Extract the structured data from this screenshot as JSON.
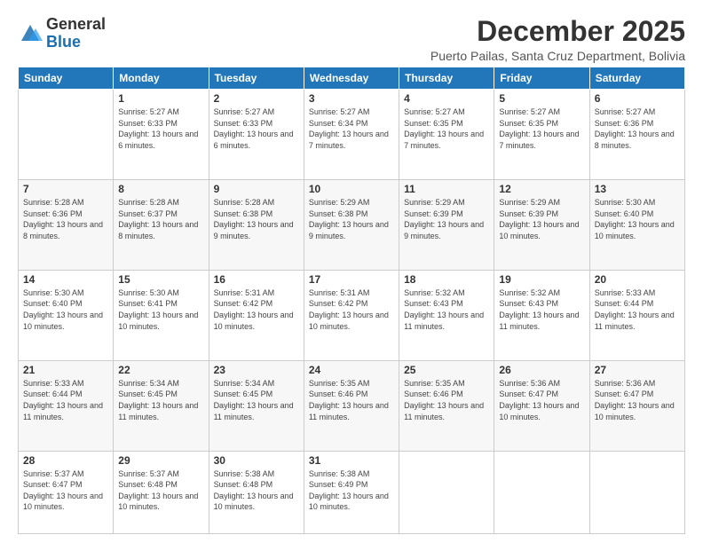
{
  "logo": {
    "general": "General",
    "blue": "Blue"
  },
  "header": {
    "month_title": "December 2025",
    "location": "Puerto Pailas, Santa Cruz Department, Bolivia"
  },
  "days_of_week": [
    "Sunday",
    "Monday",
    "Tuesday",
    "Wednesday",
    "Thursday",
    "Friday",
    "Saturday"
  ],
  "weeks": [
    [
      {
        "day": "",
        "sunrise": "",
        "sunset": "",
        "daylight": ""
      },
      {
        "day": "1",
        "sunrise": "Sunrise: 5:27 AM",
        "sunset": "Sunset: 6:33 PM",
        "daylight": "Daylight: 13 hours and 6 minutes."
      },
      {
        "day": "2",
        "sunrise": "Sunrise: 5:27 AM",
        "sunset": "Sunset: 6:33 PM",
        "daylight": "Daylight: 13 hours and 6 minutes."
      },
      {
        "day": "3",
        "sunrise": "Sunrise: 5:27 AM",
        "sunset": "Sunset: 6:34 PM",
        "daylight": "Daylight: 13 hours and 7 minutes."
      },
      {
        "day": "4",
        "sunrise": "Sunrise: 5:27 AM",
        "sunset": "Sunset: 6:35 PM",
        "daylight": "Daylight: 13 hours and 7 minutes."
      },
      {
        "day": "5",
        "sunrise": "Sunrise: 5:27 AM",
        "sunset": "Sunset: 6:35 PM",
        "daylight": "Daylight: 13 hours and 7 minutes."
      },
      {
        "day": "6",
        "sunrise": "Sunrise: 5:27 AM",
        "sunset": "Sunset: 6:36 PM",
        "daylight": "Daylight: 13 hours and 8 minutes."
      }
    ],
    [
      {
        "day": "7",
        "sunrise": "Sunrise: 5:28 AM",
        "sunset": "Sunset: 6:36 PM",
        "daylight": "Daylight: 13 hours and 8 minutes."
      },
      {
        "day": "8",
        "sunrise": "Sunrise: 5:28 AM",
        "sunset": "Sunset: 6:37 PM",
        "daylight": "Daylight: 13 hours and 8 minutes."
      },
      {
        "day": "9",
        "sunrise": "Sunrise: 5:28 AM",
        "sunset": "Sunset: 6:38 PM",
        "daylight": "Daylight: 13 hours and 9 minutes."
      },
      {
        "day": "10",
        "sunrise": "Sunrise: 5:29 AM",
        "sunset": "Sunset: 6:38 PM",
        "daylight": "Daylight: 13 hours and 9 minutes."
      },
      {
        "day": "11",
        "sunrise": "Sunrise: 5:29 AM",
        "sunset": "Sunset: 6:39 PM",
        "daylight": "Daylight: 13 hours and 9 minutes."
      },
      {
        "day": "12",
        "sunrise": "Sunrise: 5:29 AM",
        "sunset": "Sunset: 6:39 PM",
        "daylight": "Daylight: 13 hours and 10 minutes."
      },
      {
        "day": "13",
        "sunrise": "Sunrise: 5:30 AM",
        "sunset": "Sunset: 6:40 PM",
        "daylight": "Daylight: 13 hours and 10 minutes."
      }
    ],
    [
      {
        "day": "14",
        "sunrise": "Sunrise: 5:30 AM",
        "sunset": "Sunset: 6:40 PM",
        "daylight": "Daylight: 13 hours and 10 minutes."
      },
      {
        "day": "15",
        "sunrise": "Sunrise: 5:30 AM",
        "sunset": "Sunset: 6:41 PM",
        "daylight": "Daylight: 13 hours and 10 minutes."
      },
      {
        "day": "16",
        "sunrise": "Sunrise: 5:31 AM",
        "sunset": "Sunset: 6:42 PM",
        "daylight": "Daylight: 13 hours and 10 minutes."
      },
      {
        "day": "17",
        "sunrise": "Sunrise: 5:31 AM",
        "sunset": "Sunset: 6:42 PM",
        "daylight": "Daylight: 13 hours and 10 minutes."
      },
      {
        "day": "18",
        "sunrise": "Sunrise: 5:32 AM",
        "sunset": "Sunset: 6:43 PM",
        "daylight": "Daylight: 13 hours and 11 minutes."
      },
      {
        "day": "19",
        "sunrise": "Sunrise: 5:32 AM",
        "sunset": "Sunset: 6:43 PM",
        "daylight": "Daylight: 13 hours and 11 minutes."
      },
      {
        "day": "20",
        "sunrise": "Sunrise: 5:33 AM",
        "sunset": "Sunset: 6:44 PM",
        "daylight": "Daylight: 13 hours and 11 minutes."
      }
    ],
    [
      {
        "day": "21",
        "sunrise": "Sunrise: 5:33 AM",
        "sunset": "Sunset: 6:44 PM",
        "daylight": "Daylight: 13 hours and 11 minutes."
      },
      {
        "day": "22",
        "sunrise": "Sunrise: 5:34 AM",
        "sunset": "Sunset: 6:45 PM",
        "daylight": "Daylight: 13 hours and 11 minutes."
      },
      {
        "day": "23",
        "sunrise": "Sunrise: 5:34 AM",
        "sunset": "Sunset: 6:45 PM",
        "daylight": "Daylight: 13 hours and 11 minutes."
      },
      {
        "day": "24",
        "sunrise": "Sunrise: 5:35 AM",
        "sunset": "Sunset: 6:46 PM",
        "daylight": "Daylight: 13 hours and 11 minutes."
      },
      {
        "day": "25",
        "sunrise": "Sunrise: 5:35 AM",
        "sunset": "Sunset: 6:46 PM",
        "daylight": "Daylight: 13 hours and 11 minutes."
      },
      {
        "day": "26",
        "sunrise": "Sunrise: 5:36 AM",
        "sunset": "Sunset: 6:47 PM",
        "daylight": "Daylight: 13 hours and 10 minutes."
      },
      {
        "day": "27",
        "sunrise": "Sunrise: 5:36 AM",
        "sunset": "Sunset: 6:47 PM",
        "daylight": "Daylight: 13 hours and 10 minutes."
      }
    ],
    [
      {
        "day": "28",
        "sunrise": "Sunrise: 5:37 AM",
        "sunset": "Sunset: 6:47 PM",
        "daylight": "Daylight: 13 hours and 10 minutes."
      },
      {
        "day": "29",
        "sunrise": "Sunrise: 5:37 AM",
        "sunset": "Sunset: 6:48 PM",
        "daylight": "Daylight: 13 hours and 10 minutes."
      },
      {
        "day": "30",
        "sunrise": "Sunrise: 5:38 AM",
        "sunset": "Sunset: 6:48 PM",
        "daylight": "Daylight: 13 hours and 10 minutes."
      },
      {
        "day": "31",
        "sunrise": "Sunrise: 5:38 AM",
        "sunset": "Sunset: 6:49 PM",
        "daylight": "Daylight: 13 hours and 10 minutes."
      },
      {
        "day": "",
        "sunrise": "",
        "sunset": "",
        "daylight": ""
      },
      {
        "day": "",
        "sunrise": "",
        "sunset": "",
        "daylight": ""
      },
      {
        "day": "",
        "sunrise": "",
        "sunset": "",
        "daylight": ""
      }
    ]
  ]
}
